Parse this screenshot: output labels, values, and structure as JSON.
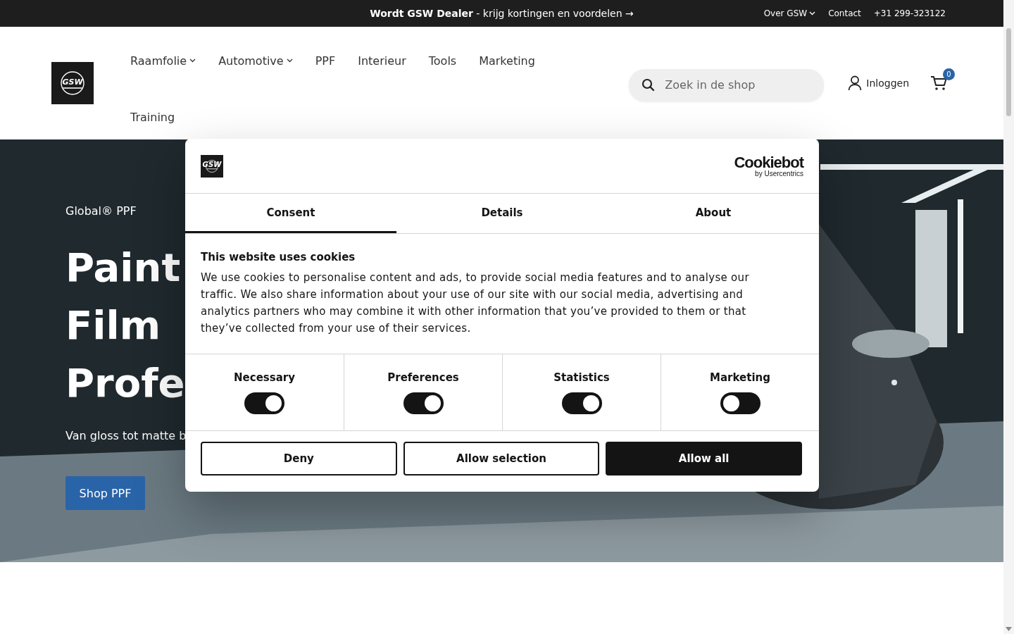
{
  "top_bar": {
    "promo": "**Wordt GSW Dealer** - krijg kortingen en voordelen →",
    "links": [
      {
        "label": "Over GSW",
        "dropdown": true
      },
      {
        "label": "Contact",
        "dropdown": false
      },
      {
        "label": "+31 299-323122",
        "dropdown": false
      }
    ]
  },
  "header": {
    "logo_text": "GSW",
    "nav": [
      {
        "label": "Raamfolie",
        "dropdown": true
      },
      {
        "label": "Automotive",
        "dropdown": true
      },
      {
        "label": "PPF",
        "dropdown": false
      },
      {
        "label": "Interieur",
        "dropdown": false
      },
      {
        "label": "Tools",
        "dropdown": false
      },
      {
        "label": "Marketing",
        "dropdown": false
      },
      {
        "label": "Training",
        "dropdown": false
      }
    ],
    "search": {
      "placeholder": "Zoek in de shop"
    },
    "account": "Inloggen",
    "cart_count": "0"
  },
  "hero": {
    "eyebrow": "Global® PPF",
    "headline_lines": [
      "Paint",
      "Film",
      "Profe"
    ],
    "subtitle": "Van gloss tot matte b",
    "button": "Shop PPF"
  },
  "cookie_dialog": {
    "logo_text": "GSW",
    "brand": "Cookiebot",
    "brand_tagline": "by Usercentrics",
    "tabs": [
      {
        "label": "Consent",
        "selected": true
      },
      {
        "label": "Details",
        "selected": false
      },
      {
        "label": "About",
        "selected": false
      }
    ],
    "title": "This website uses cookies",
    "text": "We use cookies to personalise content and ads, to provide social media features and to analyse our traffic. We also share information about your use of our site with our social media, advertising and analytics partners who may combine it with other information that you’ve provided to them or that they’ve collected from your use of their services.",
    "categories": [
      {
        "label": "Necessary",
        "checked": true
      },
      {
        "label": "Preferences",
        "checked": true
      },
      {
        "label": "Statistics",
        "checked": true
      },
      {
        "label": "Marketing",
        "checked": false
      }
    ],
    "buttons": [
      {
        "label": "Deny",
        "kind": "outline"
      },
      {
        "label": "Allow selection",
        "kind": "outline"
      },
      {
        "label": "Allow all",
        "kind": "filled"
      }
    ]
  }
}
